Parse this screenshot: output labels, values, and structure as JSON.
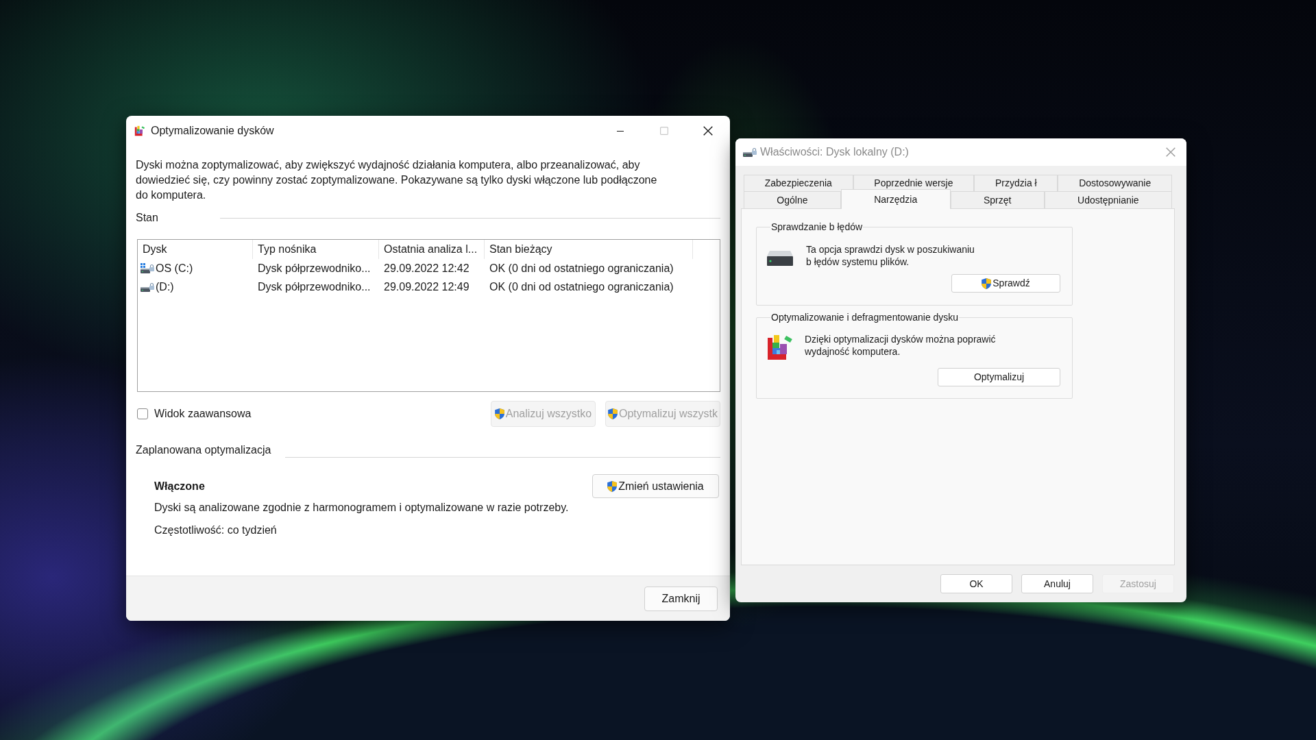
{
  "optimize_window": {
    "title": "Optymalizowanie dysków",
    "active": true,
    "controls": [
      {
        "kind": "minimize",
        "disabled": false
      },
      {
        "kind": "maximize",
        "disabled": true
      },
      {
        "kind": "close",
        "disabled": false
      }
    ],
    "description": "Dyski można zoptymalizować, aby zwiększyć wydajność działania komputera, albo przeanalizować, aby dowiedzieć się, czy powinny zostać zoptymalizowane. Pokazywane są tylko dyski włączone lub podłączone do komputera.",
    "status_label": "Stan",
    "table": {
      "columns": [
        "Dysk",
        "Typ nośnika",
        "Ostatnia analiza l...",
        "Stan bieżący"
      ],
      "rows": [
        {
          "kind": "system",
          "cells": [
            "OS (C:)",
            "Dysk półprzewodniko...",
            "29.09.2022 12:42",
            "OK (0 dni od ostatniego ograniczania)"
          ]
        },
        {
          "kind": "local",
          "cells": [
            "(D:)",
            "Dysk półprzewodniko...",
            "29.09.2022 12:49",
            "OK (0 dni od ostatniego ograniczania)"
          ]
        }
      ]
    },
    "advanced_view": {
      "label": "Widok zaawansowa",
      "checked": false
    },
    "actions": [
      {
        "label": "Analizuj wszystko",
        "disabled": true,
        "shield": true
      },
      {
        "label": "Optymalizuj wszystk",
        "disabled": true,
        "shield": true
      }
    ],
    "schedule": {
      "label": "Zaplanowana optymalizacja",
      "state": "Włączone",
      "button": {
        "label": "Zmień ustawienia",
        "shield": true
      },
      "description": "Dyski są analizowane zgodnie z harmonogramem i optymalizowane w razie potrzeby.",
      "frequency": "Częstotliwość: co tydzień"
    },
    "footer_button": "Zamknij"
  },
  "properties_window": {
    "title": "Właściwości: Dysk lokalny (D:)",
    "active": false,
    "controls": [
      {
        "kind": "close",
        "disabled": false
      }
    ],
    "tab_rows": [
      {
        "tabs": [
          {
            "label": "Zabezpieczenia",
            "selected": false
          },
          {
            "label": "Poprzednie wersje",
            "selected": false
          },
          {
            "label": "Przydzia ł",
            "selected": false
          },
          {
            "label": "Dostosowywanie",
            "selected": false
          }
        ]
      },
      {
        "tabs": [
          {
            "label": "Ogólne",
            "selected": false
          },
          {
            "label": "Narzędzia",
            "selected": true
          },
          {
            "label": "Sprzęt",
            "selected": false
          },
          {
            "label": "Udostępnianie",
            "selected": false
          }
        ]
      }
    ],
    "groups": [
      {
        "kind": "error_check",
        "title": "Sprawdzanie b łędów",
        "description": "Ta opcja sprawdzi dysk w poszukiwaniu b łędów systemu plików.",
        "button": {
          "label": "Sprawdź",
          "shield": true
        }
      },
      {
        "kind": "optimize",
        "title": "Optymalizowanie i defragmentowanie dysku",
        "description": "Dzięki optymalizacji dysków można poprawić wydajność komputera.",
        "button": {
          "label": "Optymalizuj",
          "shield": false
        }
      }
    ],
    "buttons": [
      {
        "label": "OK",
        "disabled": false
      },
      {
        "label": "Anuluj",
        "disabled": false
      },
      {
        "label": "Zastosuj",
        "disabled": true
      }
    ]
  }
}
